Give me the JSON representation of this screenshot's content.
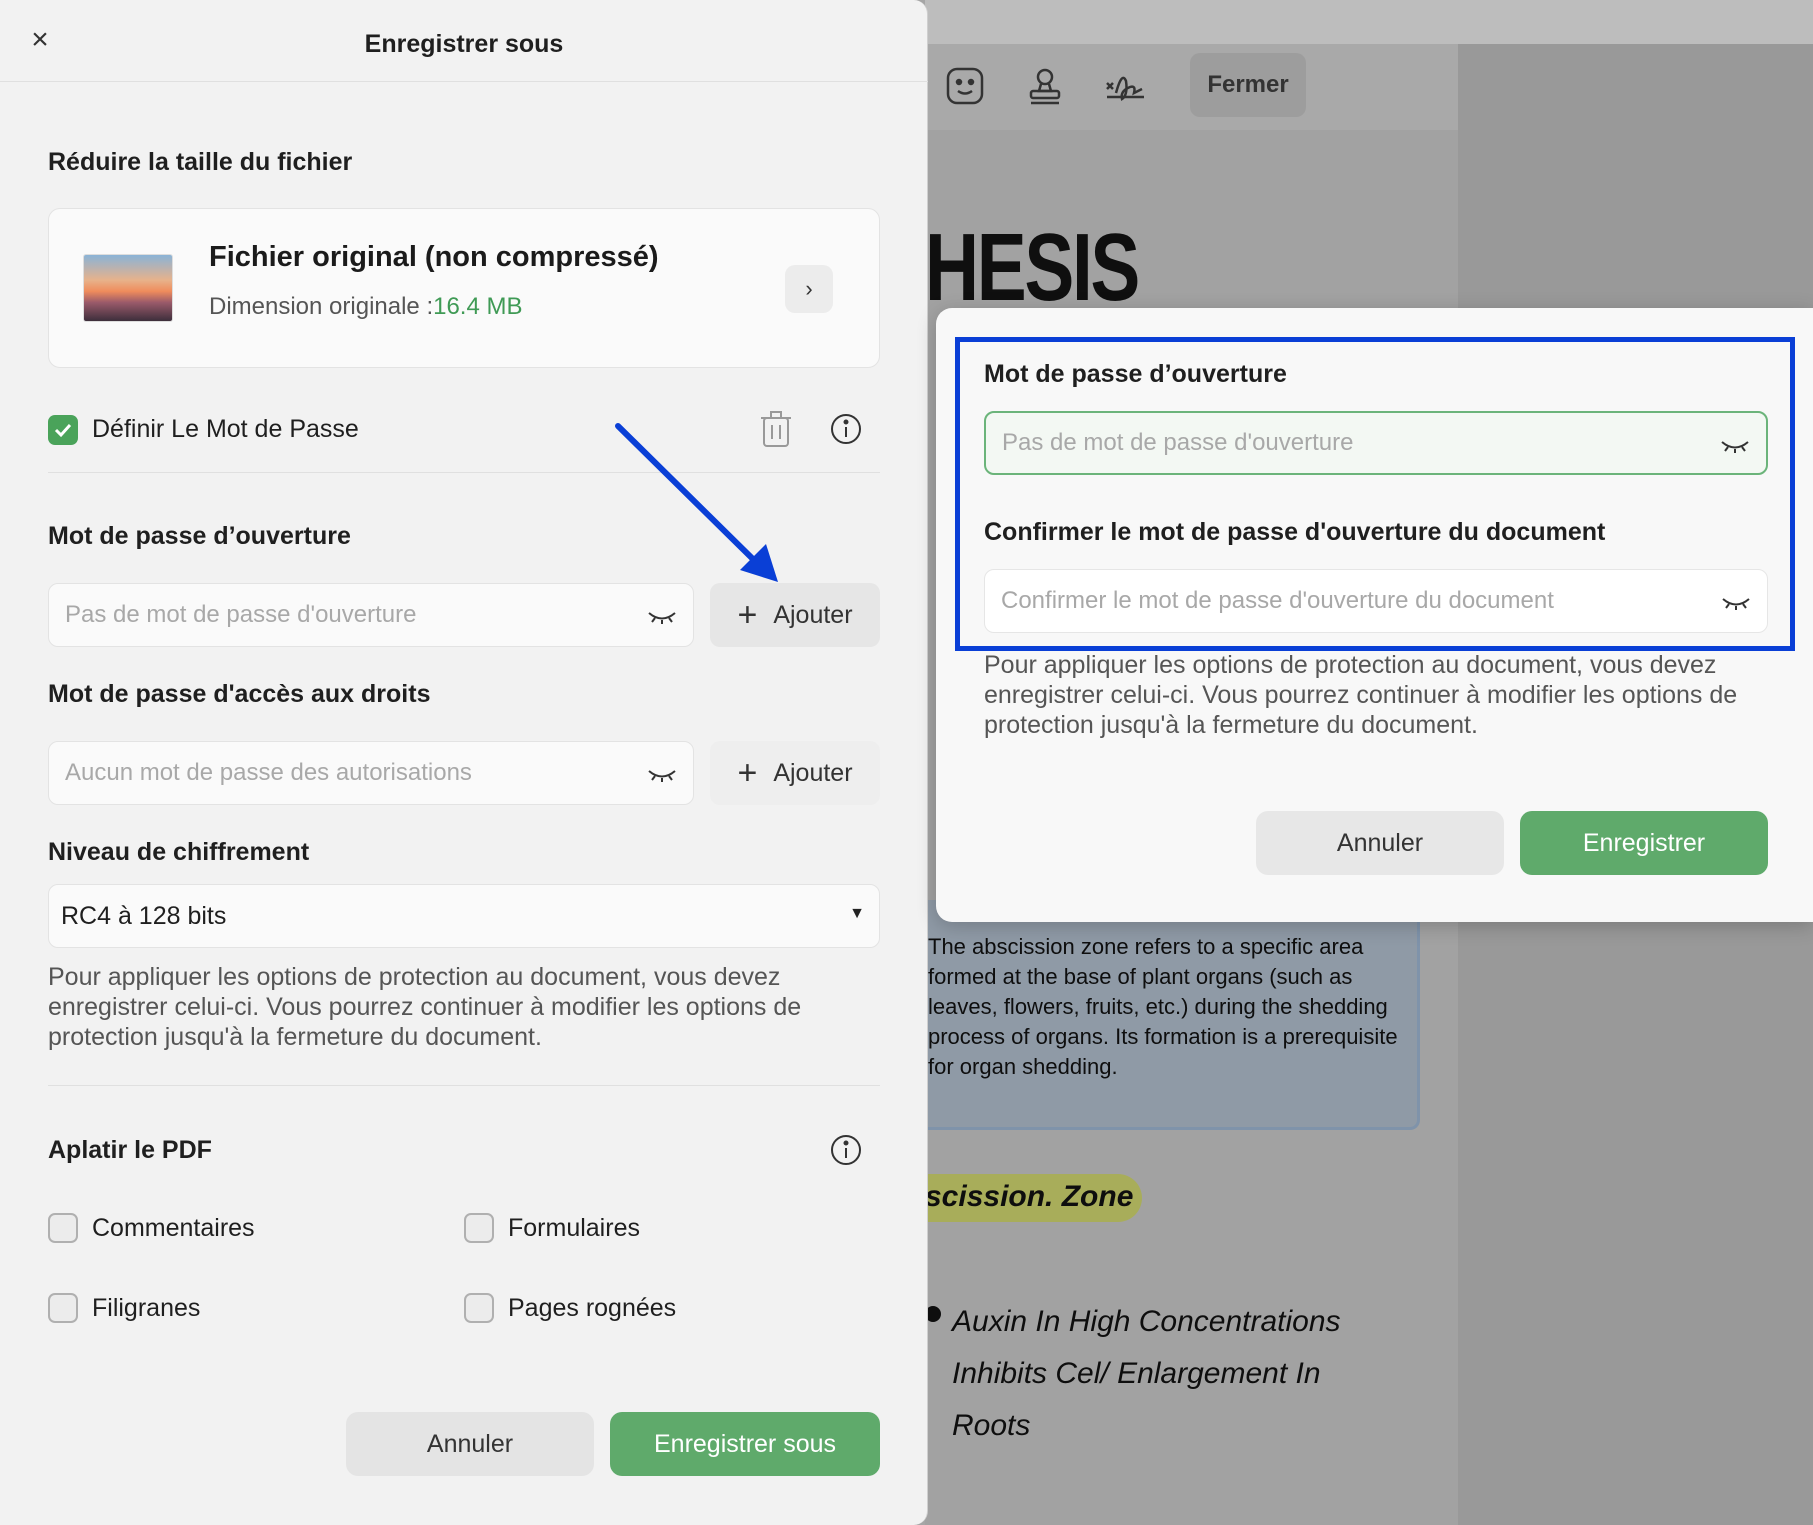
{
  "save_dialog": {
    "close_label": "×",
    "title": "Enregistrer sous",
    "reduce_section_title": "Réduire la taille du fichier",
    "file_card": {
      "title": "Fichier original (non compressé)",
      "size_prefix": "Dimension originale :",
      "size_value": "16.4 MB",
      "chevron": "›"
    },
    "set_password": {
      "label": "Définir Le Mot de Passe",
      "checked": true
    },
    "open_password": {
      "title": "Mot de passe d’ouverture",
      "placeholder": "Pas de mot de passe d'ouverture",
      "add_label": "Ajouter"
    },
    "rights_password": {
      "title": "Mot de passe d'accès aux droits",
      "placeholder": "Aucun mot de passe des autorisations",
      "add_label": "Ajouter"
    },
    "encryption": {
      "title": "Niveau de chiffrement",
      "selected": "RC4 à 128 bits"
    },
    "note": "Pour appliquer les options de protection au document, vous devez enregistrer celui-ci. Vous pourrez continuer à modifier les options de protection jusqu'à la fermeture du document.",
    "flatten": {
      "title": "Aplatir le PDF",
      "options": [
        "Commentaires",
        "Formulaires",
        "Filigranes",
        "Pages rognées"
      ]
    },
    "cancel_label": "Annuler",
    "save_label": "Enregistrer sous"
  },
  "password_popup": {
    "open_password_title": "Mot de passe d’ouverture",
    "open_password_placeholder": "Pas de mot de passe d'ouverture",
    "confirm_title": "Confirmer le mot de passe d'ouverture du document",
    "confirm_placeholder": "Confirmer le mot de passe d'ouverture du document",
    "note": "Pour appliquer les options de protection au document, vous devez enregistrer celui-ci. Vous pourrez continuer à modifier les options de protection jusqu'à la fermeture du document.",
    "cancel_label": "Annuler",
    "save_label": "Enregistrer"
  },
  "background_app": {
    "close_button": "Fermer",
    "doc_heading_fragment": "HESIS",
    "doc_paragraph": "The abscission zone refers to a specific area formed at the base of plant organs (such as leaves, flowers, fruits, etc.) during the shedding process of organs. Its formation is a prerequisite for organ shedding.",
    "zone_label": "scission. Zone",
    "bullet_text": "Auxin In High Concentrations Inhibits Cel/ Enlargement In Roots"
  },
  "colors": {
    "accent_green": "#5faa6b",
    "highlight_blue": "#0a3fd6",
    "size_green": "#3f9a55"
  }
}
